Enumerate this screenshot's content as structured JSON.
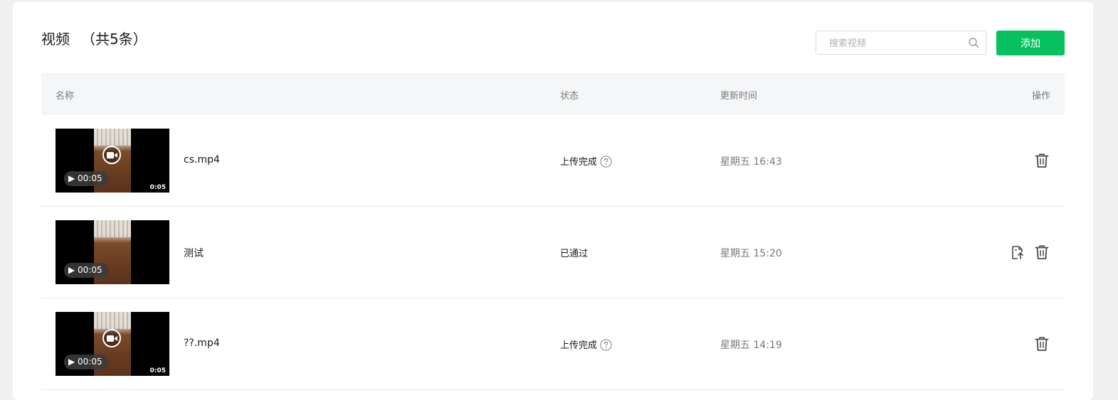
{
  "header": {
    "title": "视频",
    "count": "（共5条）"
  },
  "search": {
    "placeholder": "搜索视频",
    "value": ""
  },
  "add_button": {
    "label": "添加",
    "color": "#07c160"
  },
  "table": {
    "columns": {
      "name": "名称",
      "status": "状态",
      "time": "更新时间",
      "actions": "操作"
    },
    "rows": [
      {
        "name": "cs.mp4",
        "status": "上传完成",
        "time": "星期五 16:43",
        "duration_pill": "▶ 00:05",
        "duration_small": "0:05",
        "has_help_icon": true,
        "has_camera_icon": true,
        "actions": [
          "trash-icon"
        ]
      },
      {
        "name": "测试",
        "status": "已通过",
        "time": "星期五 15:20",
        "duration_pill": "▶ 00:05",
        "duration_small": "",
        "has_help_icon": false,
        "has_camera_icon": false,
        "actions": [
          "export-icon",
          "trash-icon"
        ]
      },
      {
        "name": "??.mp4",
        "status": "上传完成",
        "time": "星期五 14:19",
        "duration_pill": "▶ 00:05",
        "duration_small": "0:05",
        "has_help_icon": true,
        "has_camera_icon": true,
        "actions": [
          "trash-icon"
        ]
      }
    ]
  }
}
